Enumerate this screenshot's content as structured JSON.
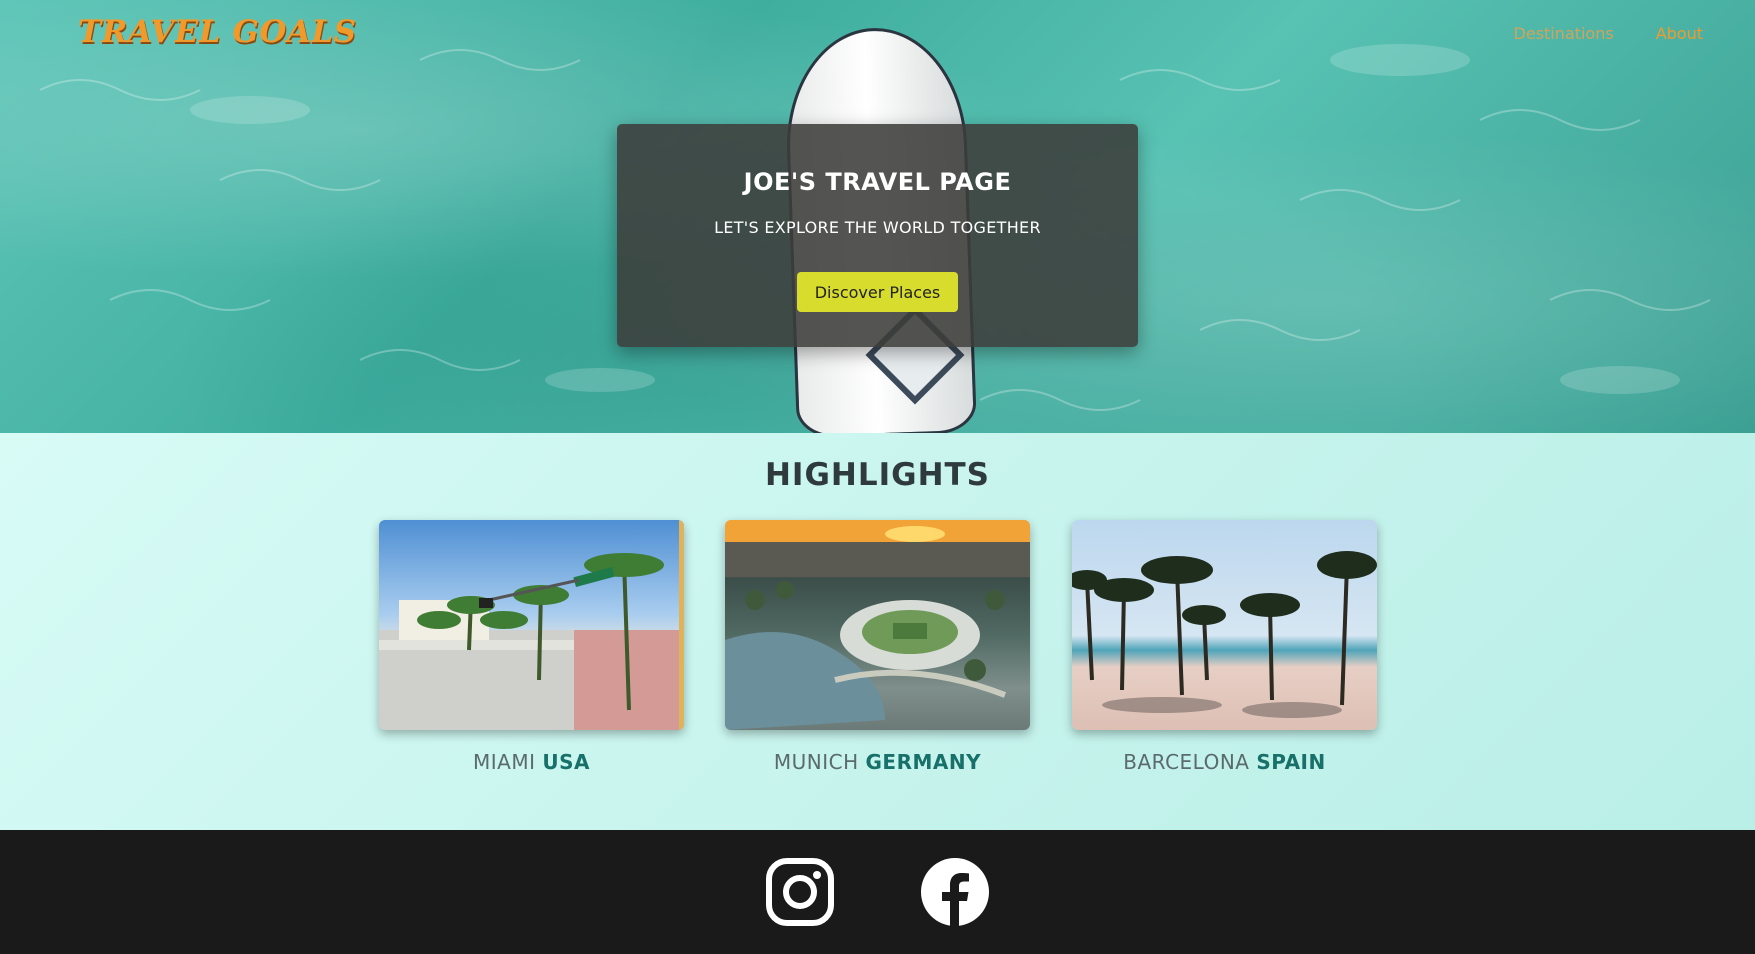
{
  "header": {
    "brand": "TRAVEL GOALS",
    "nav": [
      {
        "label": "Destinations"
      },
      {
        "label": "About"
      }
    ]
  },
  "hero": {
    "title": "JOE'S TRAVEL PAGE",
    "subtitle": "LET'S EXPLORE THE WORLD TOGETHER",
    "cta_label": "Discover Places"
  },
  "highlights": {
    "title": "HIGHLIGHTS",
    "cards": [
      {
        "city": "MIAMI",
        "country": "USA"
      },
      {
        "city": "MUNICH",
        "country": "GERMANY"
      },
      {
        "city": "BARCELONA",
        "country": "SPAIN"
      }
    ]
  },
  "footer": {
    "icons": [
      "instagram-icon",
      "facebook-icon"
    ]
  },
  "colors": {
    "brand": "#f09a2c",
    "cta": "#d8dd2d",
    "country_accent": "#18706a",
    "footer_bg": "#1a1a1a"
  }
}
